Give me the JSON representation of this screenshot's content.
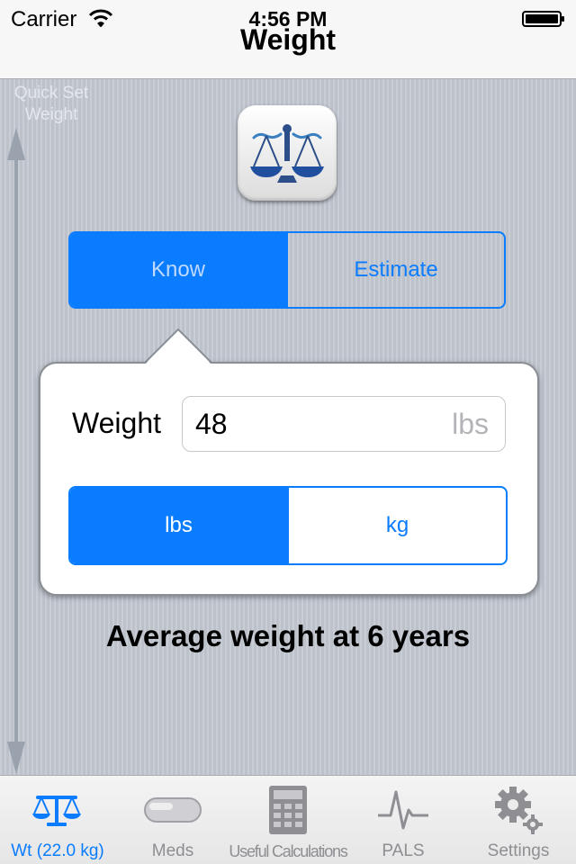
{
  "status_bar": {
    "carrier": "Carrier",
    "time": "4:56 PM"
  },
  "nav": {
    "title": "Weight"
  },
  "quick_set": {
    "label": "Quick Set Weight"
  },
  "mode_segment": {
    "options": [
      "Know",
      "Estimate"
    ],
    "selected": "Know"
  },
  "weight_entry": {
    "label": "Weight",
    "value": "48",
    "unit_placeholder": "lbs"
  },
  "unit_segment": {
    "options": [
      "lbs",
      "kg"
    ],
    "selected": "lbs"
  },
  "caption": "Average weight at 6 years",
  "tab_bar": {
    "items": [
      {
        "label": "Wt (22.0 kg)",
        "icon": "scale-icon",
        "active": true
      },
      {
        "label": "Meds",
        "icon": "pill-icon",
        "active": false
      },
      {
        "label": "Useful Calculations",
        "icon": "calculator-icon",
        "active": false
      },
      {
        "label": "PALS",
        "icon": "heartbeat-icon",
        "active": false
      },
      {
        "label": "Settings",
        "icon": "gear-icon",
        "active": false
      }
    ]
  },
  "colors": {
    "accent": "#0a7cff",
    "background": "#c2c7d1",
    "inactive_tab": "#8e8e93"
  }
}
